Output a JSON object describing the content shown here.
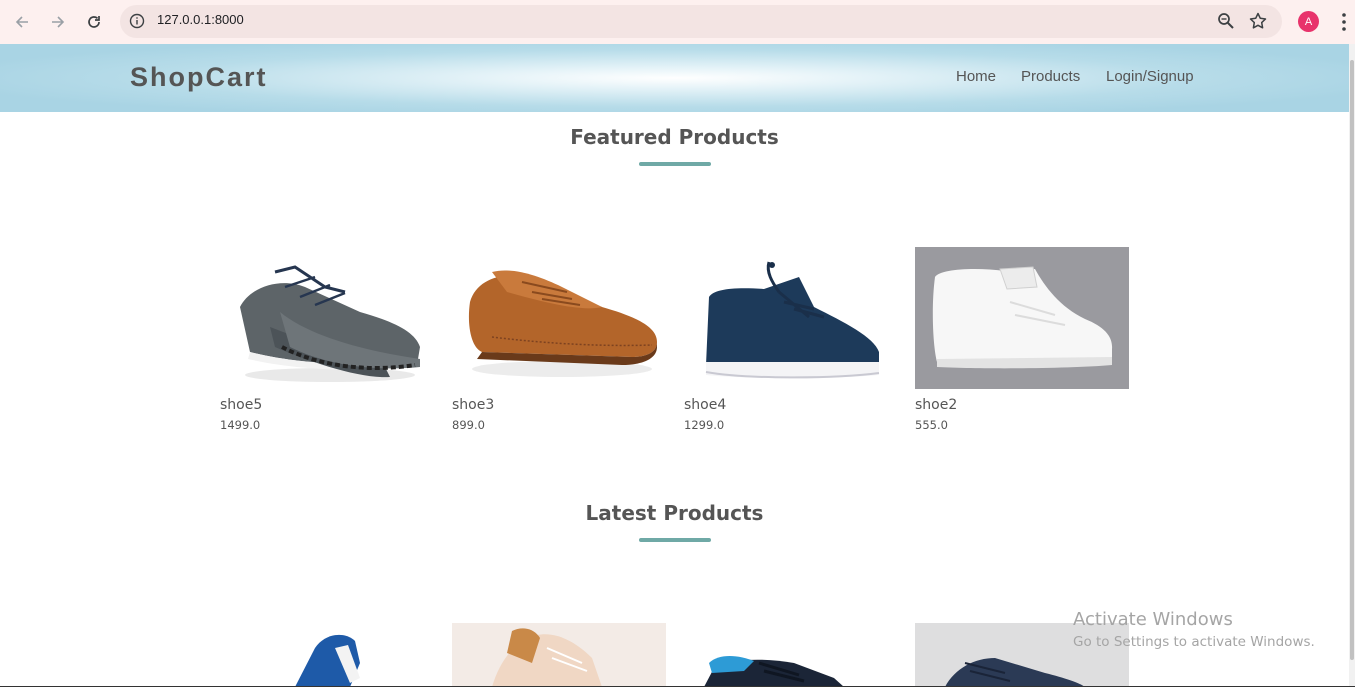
{
  "browser": {
    "url": "127.0.0.1:8000",
    "avatar_letter": "A",
    "icons": [
      "back-arrow-icon",
      "forward-arrow-icon",
      "reload-icon",
      "site-info-icon",
      "zoom-icon",
      "bookmark-star-icon",
      "kebab-menu-icon"
    ]
  },
  "site": {
    "logo": "ShopCart",
    "nav": [
      "Home",
      "Products",
      "Login/Signup"
    ]
  },
  "featured": {
    "title": "Featured Products",
    "products": [
      {
        "name": "shoe5",
        "price": "1499.0"
      },
      {
        "name": "shoe3",
        "price": "899.0"
      },
      {
        "name": "shoe4",
        "price": "1299.0"
      },
      {
        "name": "shoe2",
        "price": "555.0"
      }
    ]
  },
  "latest": {
    "title": "Latest Products"
  },
  "watermark": {
    "title": "Activate Windows",
    "subtitle": "Go to Settings to activate Windows."
  },
  "colors": {
    "accent_underline": "#6fa9a6",
    "header_blue": "#a9d4e4",
    "text_gray": "#555555",
    "avatar_pink": "#e8336b"
  }
}
